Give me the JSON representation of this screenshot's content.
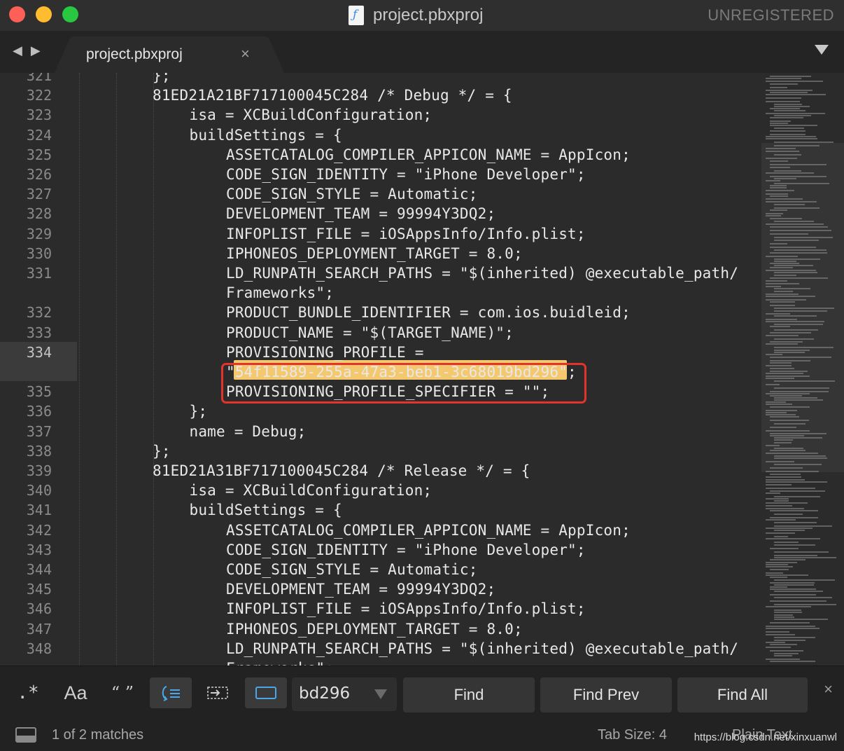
{
  "window": {
    "title": "project.pbxproj",
    "license_status": "UNREGISTERED"
  },
  "tab": {
    "label": "project.pbxproj",
    "close_glyph": "×"
  },
  "nav": {
    "back": "◀",
    "forward": "▶"
  },
  "editor": {
    "current_line": "334",
    "lines": [
      {
        "num": "321",
        "indent": 4,
        "text": "};"
      },
      {
        "num": "322",
        "indent": 4,
        "text": "81ED21A21BF717100045C284 /* Debug */ = {"
      },
      {
        "num": "323",
        "indent": 5,
        "text": "isa = XCBuildConfiguration;"
      },
      {
        "num": "324",
        "indent": 5,
        "text": "buildSettings = {"
      },
      {
        "num": "325",
        "indent": 6,
        "text": "ASSETCATALOG_COMPILER_APPICON_NAME = AppIcon;"
      },
      {
        "num": "326",
        "indent": 6,
        "text": "CODE_SIGN_IDENTITY = \"iPhone Developer\";"
      },
      {
        "num": "327",
        "indent": 6,
        "text": "CODE_SIGN_STYLE = Automatic;"
      },
      {
        "num": "328",
        "indent": 6,
        "text": "DEVELOPMENT_TEAM = 99994Y3DQ2;"
      },
      {
        "num": "329",
        "indent": 6,
        "text": "INFOPLIST_FILE = iOSAppsInfo/Info.plist;"
      },
      {
        "num": "330",
        "indent": 6,
        "text": "IPHONEOS_DEPLOYMENT_TARGET = 8.0;"
      },
      {
        "num": "331",
        "indent": 6,
        "text": "LD_RUNPATH_SEARCH_PATHS = \"$(inherited) @executable_path/"
      },
      {
        "num": "",
        "indent": 6,
        "text": "Frameworks\";"
      },
      {
        "num": "332",
        "indent": 6,
        "text": "PRODUCT_BUNDLE_IDENTIFIER = com.ios.buidleid;"
      },
      {
        "num": "333",
        "indent": 6,
        "text": "PRODUCT_NAME = \"$(TARGET_NAME)\";"
      },
      {
        "num": "334",
        "indent": 6,
        "text": "PROVISIONING_PROFILE ="
      },
      {
        "num": "",
        "indent": 6,
        "text": "\"54f11589-255a-47a3-beb1-3c68019bd296\";"
      },
      {
        "num": "335",
        "indent": 6,
        "text": "PROVISIONING_PROFILE_SPECIFIER = \"\";"
      },
      {
        "num": "336",
        "indent": 5,
        "text": "};"
      },
      {
        "num": "337",
        "indent": 5,
        "text": "name = Debug;"
      },
      {
        "num": "338",
        "indent": 4,
        "text": "};"
      },
      {
        "num": "339",
        "indent": 4,
        "text": "81ED21A31BF717100045C284 /* Release */ = {"
      },
      {
        "num": "340",
        "indent": 5,
        "text": "isa = XCBuildConfiguration;"
      },
      {
        "num": "341",
        "indent": 5,
        "text": "buildSettings = {"
      },
      {
        "num": "342",
        "indent": 6,
        "text": "ASSETCATALOG_COMPILER_APPICON_NAME = AppIcon;"
      },
      {
        "num": "343",
        "indent": 6,
        "text": "CODE_SIGN_IDENTITY = \"iPhone Developer\";"
      },
      {
        "num": "344",
        "indent": 6,
        "text": "CODE_SIGN_STYLE = Automatic;"
      },
      {
        "num": "345",
        "indent": 6,
        "text": "DEVELOPMENT_TEAM = 99994Y3DQ2;"
      },
      {
        "num": "346",
        "indent": 6,
        "text": "INFOPLIST_FILE = iOSAppsInfo/Info.plist;"
      },
      {
        "num": "347",
        "indent": 6,
        "text": "IPHONEOS_DEPLOYMENT_TARGET = 8.0;"
      },
      {
        "num": "348",
        "indent": 6,
        "text": "LD_RUNPATH_SEARCH_PATHS = \"$(inherited) @executable_path/"
      },
      {
        "num": "",
        "indent": 6,
        "text": "Frameworks\";"
      }
    ],
    "highlight_color": "#f4c86e",
    "annotation_color": "#e2342a"
  },
  "find": {
    "opt_regex": ".*",
    "opt_case": "Aa",
    "opt_word": "“ ”",
    "query": "bd296",
    "find_label": "Find",
    "find_prev_label": "Find Prev",
    "find_all_label": "Find All",
    "close_glyph": "×"
  },
  "status": {
    "matches": "1 of 2 matches",
    "tab_size": "Tab Size: 4",
    "syntax": "Plain Text",
    "watermark": "https://blog.csdn.net/xinxuanwl"
  }
}
